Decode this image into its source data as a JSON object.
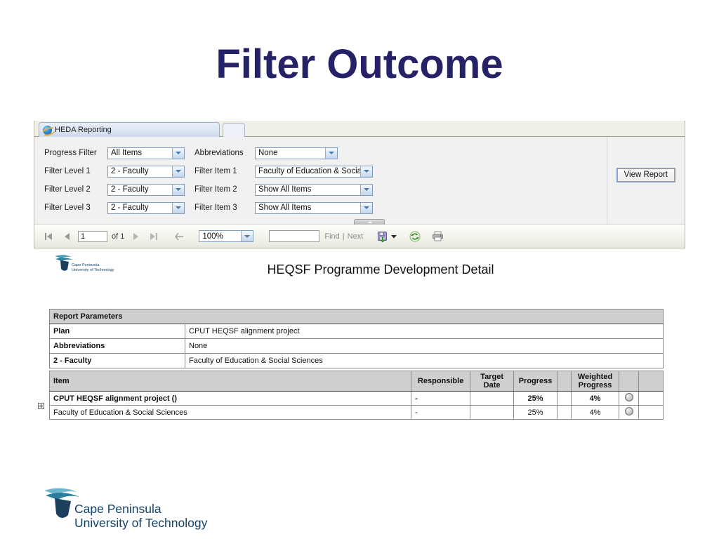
{
  "slide": {
    "title": "Filter Outcome",
    "title_color": "#252268"
  },
  "browser": {
    "tab_label": "HEDA Reporting",
    "tab_icon": "internet-explorer-icon",
    "new_tab_icon": "new-tab-icon"
  },
  "filter_panel": {
    "rows_left": [
      {
        "label": "Progress Filter",
        "value": "All Items"
      },
      {
        "label": "Filter Level 1",
        "value": "2 - Faculty"
      },
      {
        "label": "Filter Level 2",
        "value": "2 - Faculty"
      },
      {
        "label": "Filter Level 3",
        "value": "2 - Faculty"
      }
    ],
    "rows_right": [
      {
        "label": "Abbreviations",
        "value": "None"
      },
      {
        "label": "Filter Item 1",
        "value": "Faculty of Education & Social Sc"
      },
      {
        "label": "Filter Item 2",
        "value": "Show All Items"
      },
      {
        "label": "Filter Item 3",
        "value": "Show All Items"
      }
    ],
    "view_report_label": "View Report"
  },
  "toolbar": {
    "first_page_icon": "first-page-icon",
    "prev_page_icon": "previous-page-icon",
    "page_number": "1",
    "of_label": "of 1",
    "next_page_icon": "next-page-icon",
    "last_page_icon": "last-page-icon",
    "back_icon": "back-to-parent-report-icon",
    "zoom_value": "100%",
    "find_value": "",
    "find_label": "Find",
    "separator": "|",
    "next_label": "Next",
    "export_icon": "export-save-icon",
    "export_dropdown_icon": "chevron-down-icon",
    "refresh_icon": "refresh-icon",
    "print_icon": "print-icon"
  },
  "report": {
    "title": "HEQSF Programme Development Detail",
    "logo_line1": "Cape Peninsula",
    "logo_line2": "University of Technology",
    "params": {
      "header": "Report Parameters",
      "rows": [
        {
          "key": "Plan",
          "value": "CPUT HEQSF alignment project"
        },
        {
          "key": "Abbreviations",
          "value": "None"
        },
        {
          "key": "2 - Faculty",
          "value": "Faculty of Education & Social Sciences"
        }
      ]
    },
    "table": {
      "columns": [
        "Item",
        "Responsible",
        "Target Date",
        "Progress",
        "Weighted Progress",
        "",
        ""
      ],
      "rows": [
        {
          "item": "CPUT HEQSF alignment project ()",
          "responsible": "-",
          "target_date": "",
          "progress": "25%",
          "weighted_progress": "4%",
          "status": "status-dot-gray",
          "bold": true,
          "expandable": false
        },
        {
          "item": "Faculty of Education & Social Sciences",
          "responsible": "-",
          "target_date": "",
          "progress": "25%",
          "weighted_progress": "4%",
          "status": "status-dot-gray",
          "bold": false,
          "expandable": true
        }
      ]
    }
  },
  "footer": {
    "logo_line1": "Cape Peninsula",
    "logo_line2": "University of Technology",
    "logo_icon": "cput-wave-logo"
  }
}
